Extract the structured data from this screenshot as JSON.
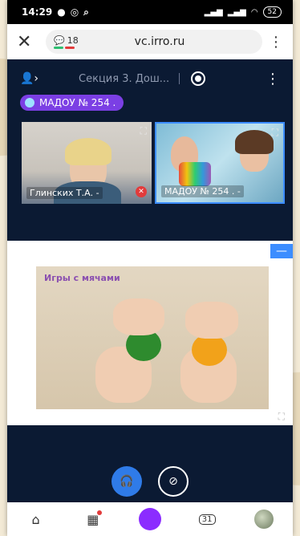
{
  "status_bar": {
    "time": "14:29",
    "battery": "52"
  },
  "browser": {
    "close_icon": "close-icon",
    "chat_count": "18",
    "url": "vc.irro.ru",
    "menu_icon": "kebab-icon"
  },
  "conference": {
    "title": "Секция 3. Дош...",
    "speaker": "МАДОУ № 254 ."
  },
  "participants": [
    {
      "label": "Глинских Т.А. -"
    },
    {
      "label": "МАДОУ № 254 . -"
    }
  ],
  "shared_slide": {
    "title": "Игры с мячами"
  },
  "colors": {
    "accent": "#3c8dff",
    "pill": "#7b3fe4",
    "background": "#0b1a33"
  },
  "bottom_nav": {
    "calendar": "31"
  }
}
